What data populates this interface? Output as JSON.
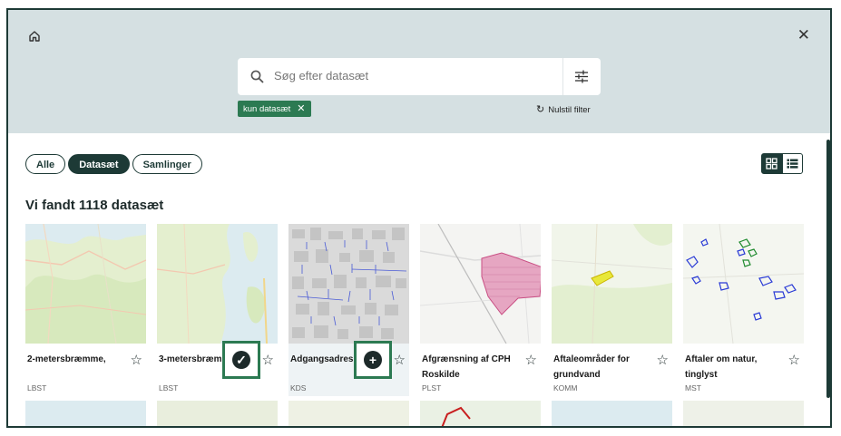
{
  "search": {
    "placeholder": "Søg efter datasæt"
  },
  "filter_chip": {
    "label": "kun datasæt"
  },
  "reset": {
    "label": "Nulstil filter"
  },
  "tabs": [
    {
      "label": "Alle"
    },
    {
      "label": "Datasæt"
    },
    {
      "label": "Samlinger"
    }
  ],
  "results": {
    "heading": "Vi fandt 1118 datasæt"
  },
  "cards": [
    {
      "title": "2-metersbræmme,",
      "org": "LBST",
      "thumb": "map-green"
    },
    {
      "title": "3-metersbræmme,",
      "org": "LBST",
      "thumb": "map-green2"
    },
    {
      "title": "Adgangsadressee r",
      "org": "KDS",
      "thumb": "map-city"
    },
    {
      "title": "Afgrænsning af CPH Roskilde",
      "org": "PLST",
      "thumb": "map-pink"
    },
    {
      "title": "Aftaleområder for grundvand",
      "org": "KOMM",
      "thumb": "map-yellow"
    },
    {
      "title": "Aftaler om natur, tinglyst",
      "org": "MST",
      "thumb": "map-blue"
    }
  ],
  "colors": {
    "accent": "#1d3a36",
    "chip": "#2c7a52",
    "header_bg": "#d5e0e2"
  },
  "icons": {
    "home": "home-icon",
    "close": "close-icon",
    "search": "search-icon",
    "filter": "sliders-icon",
    "star": "star-icon",
    "check": "check-icon",
    "add": "plus-icon"
  }
}
